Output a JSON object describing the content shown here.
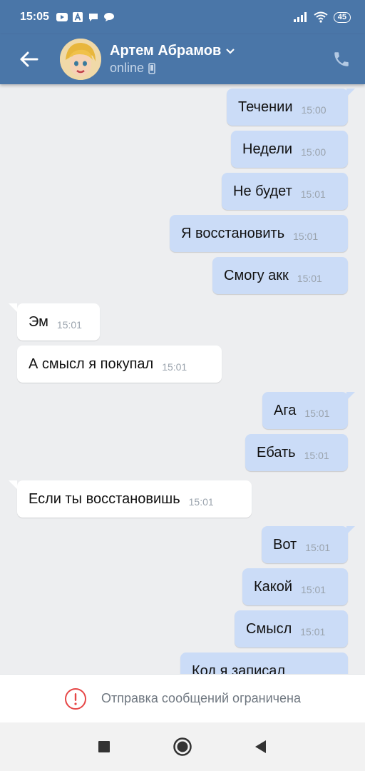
{
  "status_bar": {
    "time": "15:05",
    "battery": "45"
  },
  "header": {
    "contact_name": "Артем Абрамов",
    "presence": "online"
  },
  "messages": [
    {
      "direction": "out",
      "text": "Течении",
      "time": "15:00"
    },
    {
      "direction": "out",
      "text": "Недели",
      "time": "15:00"
    },
    {
      "direction": "out",
      "text": "Не будет",
      "time": "15:01"
    },
    {
      "direction": "out",
      "text": "Я восстановить",
      "time": "15:01"
    },
    {
      "direction": "out",
      "text": "Смогу акк",
      "time": "15:01"
    },
    {
      "direction": "in",
      "text": "Эм",
      "time": "15:01"
    },
    {
      "direction": "in",
      "text": "А смысл я покупал",
      "time": "15:01"
    },
    {
      "direction": "out",
      "text": "Ага",
      "time": "15:01"
    },
    {
      "direction": "out",
      "text": "Ебать",
      "time": "15:01"
    },
    {
      "direction": "in",
      "text": "Если ты восстановишь",
      "time": "15:01"
    },
    {
      "direction": "out",
      "text": "Вот",
      "time": "15:01"
    },
    {
      "direction": "out",
      "text": "Какой",
      "time": "15:01"
    },
    {
      "direction": "out",
      "text": "Смысл",
      "time": "15:01"
    },
    {
      "direction": "out",
      "text": "Код я записал",
      "time": ""
    }
  ],
  "restriction_notice": "Отправка сообщений ограничена",
  "icons": {
    "back": "arrow-left-icon",
    "call": "phone-icon",
    "presence": "mobile-phone-icon",
    "warning": "exclamation-circle-icon",
    "nav": [
      "square-recents-icon",
      "circle-home-icon",
      "triangle-back-icon"
    ]
  },
  "colors": {
    "header": "#4a76a8",
    "outgoing_bubble": "#cbdcf7",
    "incoming_bubble": "#ffffff",
    "background": "#edeef0",
    "warning": "#e64646"
  }
}
